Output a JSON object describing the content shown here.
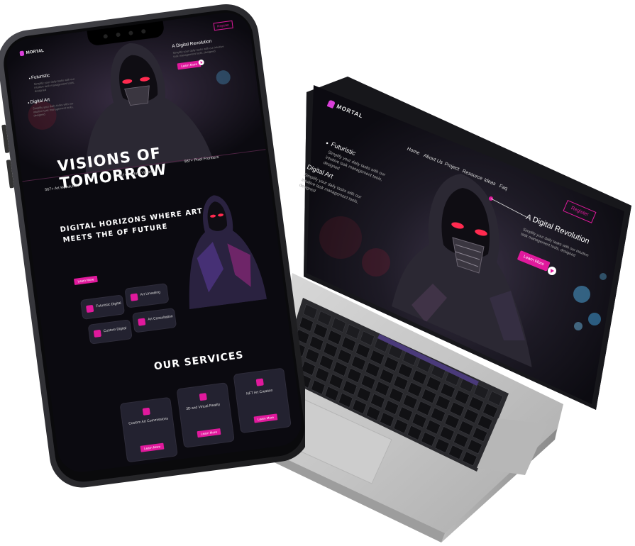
{
  "laptop": {
    "brand": "MORTAL",
    "nav": [
      "Home",
      "About Us",
      "Project",
      "Resource",
      "Ideas",
      "Faq"
    ],
    "register_label": "Register",
    "hero_items": [
      {
        "title": "Futuristic",
        "desc": "Simplify your daily tasks with our intuitive task management tools, designed"
      },
      {
        "title": "Digital Art",
        "desc": "Simplify your daily tasks with our intuitive task management tools, designed"
      }
    ],
    "hero_title": "A Digital Revolution",
    "hero_desc": "Simplify your daily tasks with our intuitive task management tools, designed",
    "learn_more": "Learn More"
  },
  "phone": {
    "brand": "MORTAL",
    "register_label": "Register",
    "hero_items": [
      {
        "title": "Futuristic",
        "desc": "Simplify your daily tasks with our intuitive task management tools, designed"
      },
      {
        "title": "Digital Art",
        "desc": "Simplify your daily tasks with our intuitive task management tools, designed"
      }
    ],
    "hero_title": "A Digital Revolution",
    "hero_desc": "Simplify your daily tasks with our intuitive task management tools, designed",
    "learn_more": "Learn More",
    "headline": "VISIONS OF TOMORROW",
    "stats": [
      {
        "label": "567+ Art Revolution"
      },
      {
        "label": "387+ Techno Visions"
      },
      {
        "label": "987+ Pixel Frontiers"
      }
    ],
    "section2_title": [
      "DIGITAL HORIZONS WHERE ART",
      "MEETS THE OF FUTURE"
    ],
    "features": [
      "Futuristic Digital",
      "Art Unveiling",
      "Custom Digital",
      "Art Consultation"
    ],
    "services_title": "OUR SERVICES",
    "services": [
      {
        "title": "Custom Art Commissions"
      },
      {
        "title": "3D and Virtual Reality"
      },
      {
        "title": "NFT Art Creation"
      }
    ]
  },
  "colors": {
    "accent": "#e0199c",
    "bg": "#0b0a10"
  }
}
